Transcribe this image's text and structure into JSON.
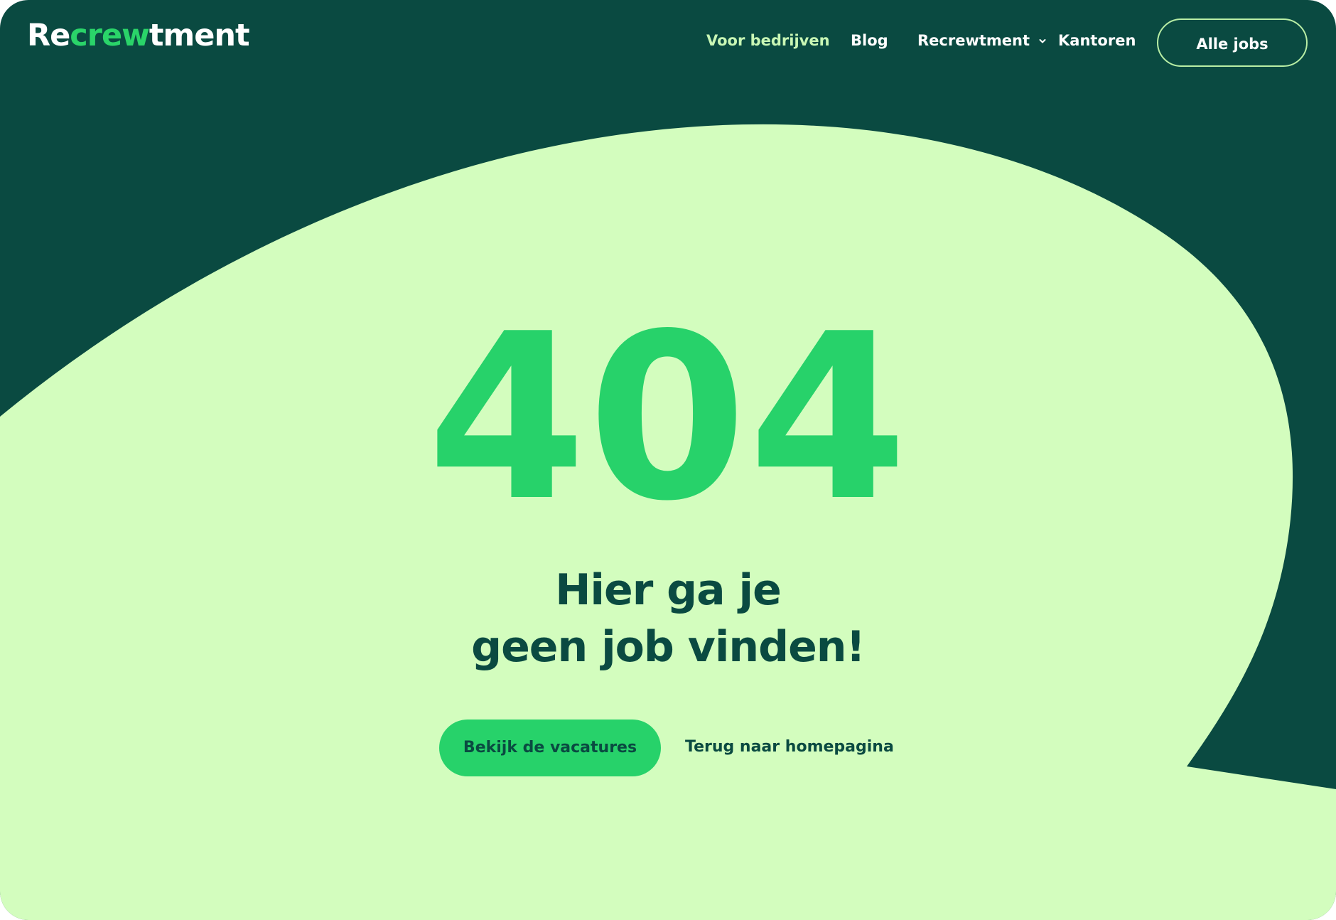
{
  "brand": {
    "logo_pre": "Re",
    "logo_hl": "crew",
    "logo_post": "tment"
  },
  "nav": {
    "items": [
      {
        "label": "Voor bedrijven",
        "active": true
      },
      {
        "label": "Blog"
      },
      {
        "label": "Recrewtment",
        "has_dropdown": true
      },
      {
        "label": "Kantoren"
      }
    ],
    "cta_label": "Alle jobs"
  },
  "error": {
    "code": "404",
    "headline_line1": "Hier ga je",
    "headline_line2": "geen job vinden!"
  },
  "actions": {
    "primary_label": "Bekijk de vacatures",
    "secondary_label": "Terug naar homepagina"
  },
  "colors": {
    "dark_green": "#0a4a41",
    "light_green": "#d3fdbe",
    "accent_green": "#27d26a",
    "nav_active": "#c9f7b5"
  },
  "icons": {
    "dropdown": "chevron-down-icon"
  }
}
